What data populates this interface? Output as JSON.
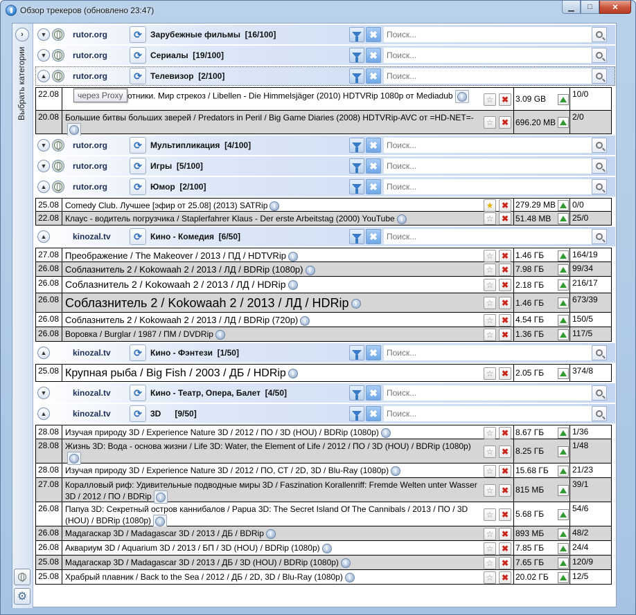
{
  "window": {
    "title": "Обзор трекеров (обновлено 23:47)",
    "min_label": "▁",
    "max_label": "□",
    "close_label": "✕"
  },
  "sidebar": {
    "label": "Выбрать категории",
    "expand_label": "›",
    "gear_label": "⚙"
  },
  "search_placeholder": "Поиск...",
  "tooltip": "через Proxy",
  "colors": {
    "accent": "#3a7bc8",
    "delete": "#c8281e",
    "seed": "#2f9a2f",
    "header_gradient_end": "#c5d6f0",
    "alt_row": "#d6d6d6"
  },
  "sections": [
    {
      "tracker": "rutor.org",
      "category": "Зарубежные фильмы  [16/100]",
      "expanded": false,
      "globe": true,
      "rows": []
    },
    {
      "tracker": "rutor.org",
      "category": "Сериалы  [19/100]",
      "expanded": false,
      "globe": true,
      "rows": []
    },
    {
      "tracker": "rutor.org",
      "category": "Телевизор  [2/100]",
      "expanded": true,
      "globe": true,
      "selected": true,
      "rows": [
        {
          "date": "22.08",
          "name": "отники. Мир стрекоз / Libellen - Die Himmelsjäger (2010) HDTVRip 1080p от Mediadub",
          "size": "3.09 GB",
          "peers": "10/0",
          "starred": false,
          "alt": false
        },
        {
          "date": "20.08",
          "name": "Большие битвы больших зверей / Predators in Peril / Big Game Diaries (2008) HDTVRip-AVC от =HD-NET=-",
          "size": "696.20 MB",
          "peers": "2/0",
          "starred": false,
          "alt": true
        }
      ]
    },
    {
      "tracker": "rutor.org",
      "category": "Мультипликация  [4/100]",
      "expanded": false,
      "globe": true,
      "rows": []
    },
    {
      "tracker": "rutor.org",
      "category": "Игры  [5/100]",
      "expanded": false,
      "globe": true,
      "rows": []
    },
    {
      "tracker": "rutor.org",
      "category": "Юмор  [2/100]",
      "expanded": true,
      "globe": true,
      "rows": [
        {
          "date": "25.08",
          "name": "Comedy Club. Лучшее [эфир от 25.08] (2013) SATRip",
          "size": "279.29 MB",
          "peers": "0/0",
          "starred": true,
          "alt": false
        },
        {
          "date": "22.08",
          "name": "Клаус - водитель погрузчика / Staplerfahrer Klaus - Der erste Arbeitstag (2000) YouTube",
          "size": "51.48 MB",
          "peers": "25/0",
          "starred": false,
          "alt": true
        }
      ]
    },
    {
      "tracker": "kinozal.tv",
      "category": "Кино - Комедия  [6/50]",
      "expanded": true,
      "globe": false,
      "rows": [
        {
          "date": "27.08",
          "name": "Преображение / The Makeover / 2013 / ПД / HDTVRip",
          "size": "1.46 ГБ",
          "peers": "164/19",
          "starred": false,
          "alt": false
        },
        {
          "date": "26.08",
          "name": "Соблазнитель 2 / Kokowaah 2 / 2013 / ЛД / BDRip (1080p)",
          "size": "7.98 ГБ",
          "peers": "99/34",
          "starred": false,
          "alt": true
        },
        {
          "date": "26.08",
          "name": "Соблазнитель 2 / Kokowaah 2 / 2013 / ЛД / HDRip",
          "size": "2.18 ГБ",
          "peers": "216/17",
          "starred": false,
          "alt": false
        },
        {
          "date": "26.08",
          "name": "Соблазнитель 2 / Kokowaah 2 / 2013 / ЛД / HDRip",
          "size": "1.46 ГБ",
          "peers": "673/39",
          "starred": false,
          "alt": true
        },
        {
          "date": "26.08",
          "name": "Соблазнитель 2 / Kokowaah 2 / 2013 / ЛД / BDRip (720p)",
          "size": "4.54 ГБ",
          "peers": "150/5",
          "starred": false,
          "alt": false
        },
        {
          "date": "26.08",
          "name": "Воровка / Burglar / 1987 / ПМ / DVDRip",
          "size": "1.36 ГБ",
          "peers": "117/5",
          "starred": false,
          "alt": true
        }
      ]
    },
    {
      "tracker": "kinozal.tv",
      "category": "Кино - Фэнтези  [1/50]",
      "expanded": true,
      "globe": false,
      "rows": [
        {
          "date": "25.08",
          "name": "Крупная рыба / Big Fish / 2003 / ДБ / HDRip",
          "size": "2.05 ГБ",
          "peers": "374/8",
          "starred": false,
          "alt": false
        }
      ]
    },
    {
      "tracker": "kinozal.tv",
      "category": "Кино - Театр, Опера, Балет  [4/50]",
      "expanded": false,
      "globe": false,
      "rows": []
    },
    {
      "tracker": "kinozal.tv",
      "category": "3D      [9/50]",
      "expanded": true,
      "globe": false,
      "rows": [
        {
          "date": "28.08",
          "name": "Изучая природу 3D / Experience Nature 3D / 2012 / ПО / 3D (HOU) / BDRip (1080p)",
          "size": "8.67 ГБ",
          "peers": "1/36",
          "starred": false,
          "alt": false
        },
        {
          "date": "28.08",
          "name": "Жизнь 3D: Вода - основа жизни / Life 3D: Water, the Element of Life / 2012 / ПО / 3D (HOU) / BDRip (1080p)",
          "size": "8.25 ГБ",
          "peers": "1/48",
          "starred": false,
          "alt": true
        },
        {
          "date": "28.08",
          "name": "Изучая природу 3D / Experience Nature 3D / 2012 / ПО, СТ / 2D, 3D / Blu-Ray (1080p)",
          "size": "15.68 ГБ",
          "peers": "21/23",
          "starred": false,
          "alt": false
        },
        {
          "date": "27.08",
          "name": "Коралловый риф: Удивительные подводные миры 3D / Faszination Korallenriff: Fremde Welten unter Wasser 3D / 2012 / ПО / BDRip",
          "size": "815 МБ",
          "peers": "39/1",
          "starred": false,
          "alt": true
        },
        {
          "date": "26.08",
          "name": "Папуа 3D: Секретный остров каннибалов / Papua 3D: The Secret Island Of The Cannibals / 2013 / ПО / 3D (HOU) / BDRip (1080p)",
          "size": "5.68 ГБ",
          "peers": "54/6",
          "starred": false,
          "alt": false
        },
        {
          "date": "26.08",
          "name": "Мадагаскар 3D / Madagascar 3D / 2013 / ДБ /  BDRip",
          "size": "893 МБ",
          "peers": "48/2",
          "starred": false,
          "alt": true
        },
        {
          "date": "26.08",
          "name": "Аквариум 3D / Aquarium 3D / 2013 / БП / 3D (HOU) / BDRip (1080p)",
          "size": "7.85 ГБ",
          "peers": "24/4",
          "starred": false,
          "alt": false
        },
        {
          "date": "25.08",
          "name": "Мадагаскар 3D / Madagascar 3D / 2013 / ДБ / 3D (HOU) / BDRip (1080p)",
          "size": "7.65 ГБ",
          "peers": "120/9",
          "starred": false,
          "alt": true
        },
        {
          "date": "25.08",
          "name": "Храбрый плавник / Back to the Sea / 2012 / ДБ / 2D, 3D / Blu-Ray (1080p)",
          "size": "20.02 ГБ",
          "peers": "12/5",
          "starred": false,
          "alt": false
        }
      ]
    }
  ]
}
